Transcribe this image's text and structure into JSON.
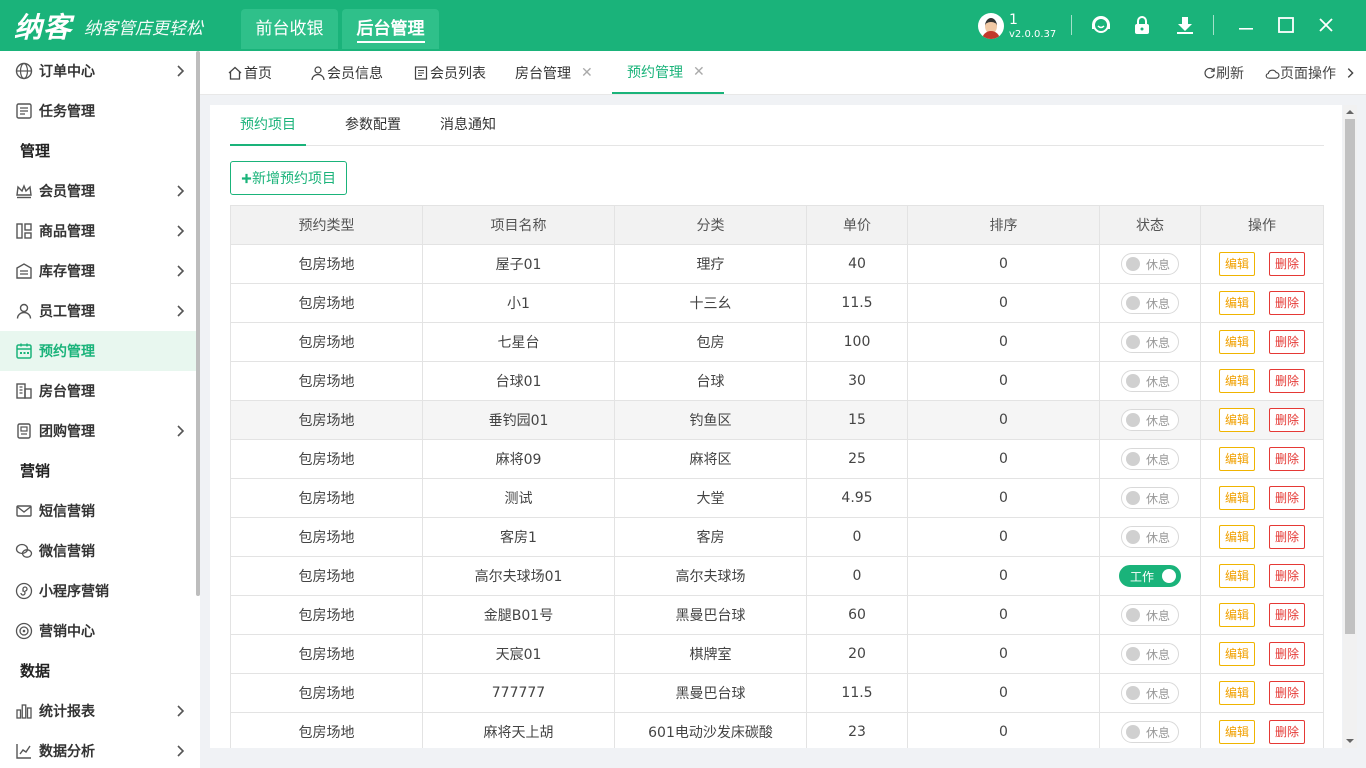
{
  "app": {
    "logo": "纳客",
    "slogan": "纳客管店更轻松",
    "top_tabs": [
      {
        "label": "前台收银"
      },
      {
        "label": "后台管理"
      }
    ],
    "user": {
      "name": "1",
      "version": "v2.0.0.37"
    }
  },
  "sidebar": {
    "items": [
      {
        "label": "订单中心"
      },
      {
        "label": "任务管理"
      },
      {
        "section": "管理"
      },
      {
        "label": "会员管理"
      },
      {
        "label": "商品管理"
      },
      {
        "label": "库存管理"
      },
      {
        "label": "员工管理"
      },
      {
        "label": "预约管理"
      },
      {
        "label": "房台管理"
      },
      {
        "label": "团购管理"
      },
      {
        "section": "营销"
      },
      {
        "label": "短信营销"
      },
      {
        "label": "微信营销"
      },
      {
        "label": "小程序营销"
      },
      {
        "label": "营销中心"
      },
      {
        "section": "数据"
      },
      {
        "label": "统计报表"
      },
      {
        "label": "数据分析"
      }
    ]
  },
  "page_tabs": {
    "tabs": [
      {
        "label": "首页"
      },
      {
        "label": "会员信息"
      },
      {
        "label": "会员列表"
      },
      {
        "label": "房台管理"
      },
      {
        "label": "预约管理"
      }
    ],
    "refresh": "刷新",
    "page_ops": "页面操作"
  },
  "subtabs": [
    {
      "label": "预约项目"
    },
    {
      "label": "参数配置"
    },
    {
      "label": "消息通知"
    }
  ],
  "add_button": "新增预约项目",
  "table": {
    "headers": [
      "预约类型",
      "项目名称",
      "分类",
      "单价",
      "排序",
      "状态",
      "操作"
    ],
    "rows": [
      {
        "type": "包房场地",
        "name": "屋子01",
        "category": "理疗",
        "price": "40",
        "sort": "0",
        "status": "休息",
        "on": false
      },
      {
        "type": "包房场地",
        "name": "小1",
        "category": "十三幺",
        "price": "11.5",
        "sort": "0",
        "status": "休息",
        "on": false
      },
      {
        "type": "包房场地",
        "name": "七星台",
        "category": "包房",
        "price": "100",
        "sort": "0",
        "status": "休息",
        "on": false
      },
      {
        "type": "包房场地",
        "name": "台球01",
        "category": "台球",
        "price": "30",
        "sort": "0",
        "status": "休息",
        "on": false
      },
      {
        "type": "包房场地",
        "name": "垂钓园01",
        "category": "钓鱼区",
        "price": "15",
        "sort": "0",
        "status": "休息",
        "on": false
      },
      {
        "type": "包房场地",
        "name": "麻将09",
        "category": "麻将区",
        "price": "25",
        "sort": "0",
        "status": "休息",
        "on": false
      },
      {
        "type": "包房场地",
        "name": "测试",
        "category": "大堂",
        "price": "4.95",
        "sort": "0",
        "status": "休息",
        "on": false
      },
      {
        "type": "包房场地",
        "name": "客房1",
        "category": "客房",
        "price": "0",
        "sort": "0",
        "status": "休息",
        "on": false
      },
      {
        "type": "包房场地",
        "name": "高尔夫球场01",
        "category": "高尔夫球场",
        "price": "0",
        "sort": "0",
        "status": "工作",
        "on": true
      },
      {
        "type": "包房场地",
        "name": "金腿B01号",
        "category": "黑曼巴台球",
        "price": "60",
        "sort": "0",
        "status": "休息",
        "on": false
      },
      {
        "type": "包房场地",
        "name": "天宸01",
        "category": "棋牌室",
        "price": "20",
        "sort": "0",
        "status": "休息",
        "on": false
      },
      {
        "type": "包房场地",
        "name": "777777",
        "category": "黑曼巴台球",
        "price": "11.5",
        "sort": "0",
        "status": "休息",
        "on": false
      },
      {
        "type": "包房场地",
        "name": "麻将天上胡",
        "category": "601电动沙发床碳酸",
        "price": "23",
        "sort": "0",
        "status": "休息",
        "on": false
      }
    ],
    "edit_label": "编辑",
    "delete_label": "删除"
  },
  "colors": {
    "brand": "#1ab37a",
    "edit": "#f0a000",
    "delete": "#e53935"
  }
}
